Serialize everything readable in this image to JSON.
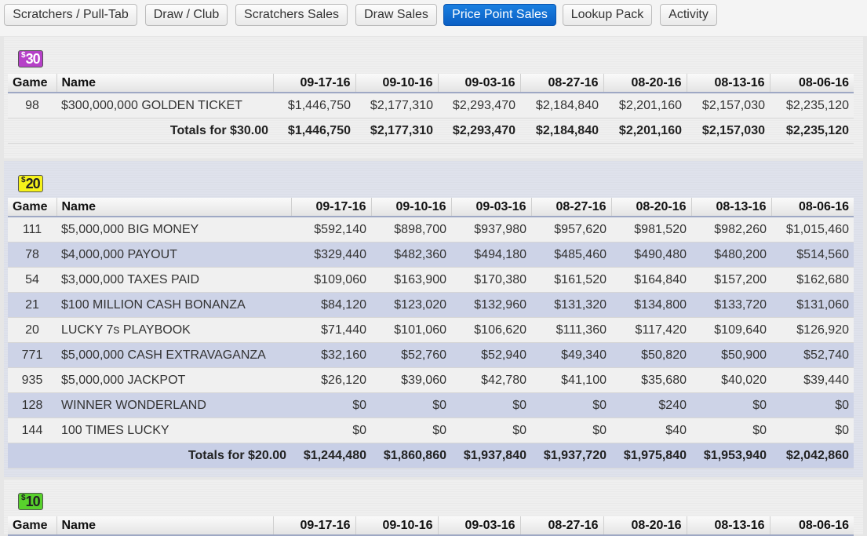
{
  "tabs": [
    {
      "label": "Scratchers / Pull-Tab",
      "active": false
    },
    {
      "label": "Draw / Club",
      "active": false
    },
    {
      "label": "Scratchers Sales",
      "active": false
    },
    {
      "label": "Draw Sales",
      "active": false
    },
    {
      "label": "Price Point Sales",
      "active": true
    },
    {
      "label": "Lookup Pack",
      "active": false
    },
    {
      "label": "Activity",
      "active": false
    }
  ],
  "columns": {
    "game": "Game",
    "name": "Name",
    "dates": [
      "09-17-16",
      "09-10-16",
      "09-03-16",
      "08-27-16",
      "08-20-16",
      "08-13-16",
      "08-06-16"
    ]
  },
  "sections": [
    {
      "badge_symbol": "$",
      "badge_amount": "30",
      "badge_color": "#b640c8",
      "rows": [
        {
          "game": "98",
          "name": "$300,000,000 GOLDEN TICKET",
          "values": [
            "$1,446,750",
            "$2,177,310",
            "$2,293,470",
            "$2,184,840",
            "$2,201,160",
            "$2,157,030",
            "$2,235,120"
          ]
        }
      ],
      "totals_label": "Totals for $30.00",
      "totals": [
        "$1,446,750",
        "$2,177,310",
        "$2,293,470",
        "$2,184,840",
        "$2,201,160",
        "$2,157,030",
        "$2,235,120"
      ]
    },
    {
      "badge_symbol": "$",
      "badge_amount": "20",
      "badge_color": "#f6f21a",
      "rows": [
        {
          "game": "111",
          "name": "$5,000,000 BIG MONEY",
          "values": [
            "$592,140",
            "$898,700",
            "$937,980",
            "$957,620",
            "$981,520",
            "$982,260",
            "$1,015,460"
          ]
        },
        {
          "game": "78",
          "name": "$4,000,000 PAYOUT",
          "values": [
            "$329,440",
            "$482,360",
            "$494,180",
            "$485,460",
            "$490,480",
            "$480,200",
            "$514,560"
          ]
        },
        {
          "game": "54",
          "name": "$3,000,000 TAXES PAID",
          "values": [
            "$109,060",
            "$163,900",
            "$170,380",
            "$161,520",
            "$164,840",
            "$157,200",
            "$162,680"
          ]
        },
        {
          "game": "21",
          "name": "$100 MILLION CASH BONANZA",
          "values": [
            "$84,120",
            "$123,020",
            "$132,960",
            "$131,320",
            "$134,800",
            "$133,720",
            "$131,060"
          ]
        },
        {
          "game": "20",
          "name": "LUCKY 7s PLAYBOOK",
          "values": [
            "$71,440",
            "$101,060",
            "$106,620",
            "$111,360",
            "$117,420",
            "$109,640",
            "$126,920"
          ]
        },
        {
          "game": "771",
          "name": "$5,000,000 CASH EXTRAVAGANZA",
          "values": [
            "$32,160",
            "$52,760",
            "$52,940",
            "$49,340",
            "$50,820",
            "$50,900",
            "$52,740"
          ]
        },
        {
          "game": "935",
          "name": "$5,000,000 JACKPOT",
          "values": [
            "$26,120",
            "$39,060",
            "$42,780",
            "$41,100",
            "$35,680",
            "$40,020",
            "$39,440"
          ]
        },
        {
          "game": "128",
          "name": "WINNER WONDERLAND",
          "values": [
            "$0",
            "$0",
            "$0",
            "$0",
            "$240",
            "$0",
            "$0"
          ]
        },
        {
          "game": "144",
          "name": "100 TIMES LUCKY",
          "values": [
            "$0",
            "$0",
            "$0",
            "$0",
            "$40",
            "$0",
            "$0"
          ]
        }
      ],
      "totals_label": "Totals for $20.00",
      "totals": [
        "$1,244,480",
        "$1,860,860",
        "$1,937,840",
        "$1,937,720",
        "$1,975,840",
        "$1,953,940",
        "$2,042,860"
      ]
    },
    {
      "badge_symbol": "$",
      "badge_amount": "10",
      "badge_color": "#58d12c",
      "rows": []
    }
  ]
}
